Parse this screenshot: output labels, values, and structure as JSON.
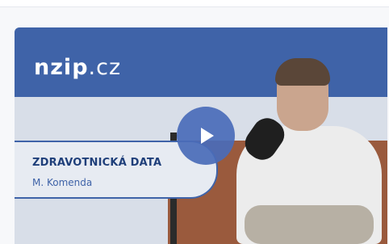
{
  "video": {
    "logo_prefix": "nzip",
    "logo_suffix": ".cz",
    "title": "ZDRAVOTNICKÁ DATA",
    "author": "M. Komenda",
    "play_icon": "play-icon",
    "accent_color": "#3f63a8"
  }
}
